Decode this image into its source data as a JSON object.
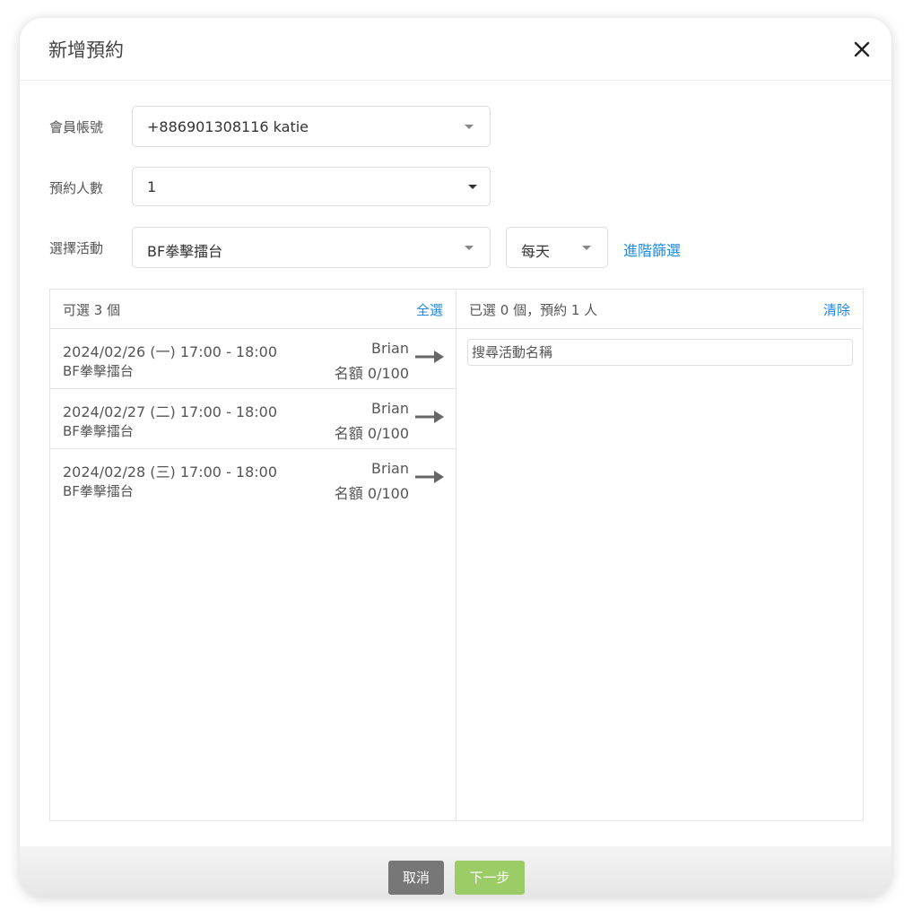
{
  "dialog": {
    "title": "新增預約"
  },
  "form": {
    "member": {
      "label": "會員帳號",
      "value": "+886901308116 katie"
    },
    "people": {
      "label": "預約人數",
      "value": "1"
    },
    "activity": {
      "label": "選擇活動",
      "value": "BF拳擊擂台"
    },
    "frequency": {
      "value": "每天"
    },
    "advanced_filter": "進階篩選"
  },
  "available": {
    "count_text": "可選 3 個",
    "select_all": "全選",
    "items": [
      {
        "date": "2024/02/26 (一) 17:00 - 18:00",
        "activity": "BF拳擊擂台",
        "coach": "Brian",
        "quota": "名額 0/100"
      },
      {
        "date": "2024/02/27 (二) 17:00 - 18:00",
        "activity": "BF拳擊擂台",
        "coach": "Brian",
        "quota": "名額 0/100"
      },
      {
        "date": "2024/02/28 (三) 17:00 - 18:00",
        "activity": "BF拳擊擂台",
        "coach": "Brian",
        "quota": "名額 0/100"
      }
    ]
  },
  "selected": {
    "count_text": "已選 0 個，預約 1 人",
    "clear": "清除",
    "search_placeholder": "搜尋活動名稱"
  },
  "footer": {
    "cancel": "取消",
    "next": "下一步"
  },
  "colors": {
    "link": "#1e88e5",
    "cancel_button": "#777777",
    "next_button": "#9ccc65"
  }
}
